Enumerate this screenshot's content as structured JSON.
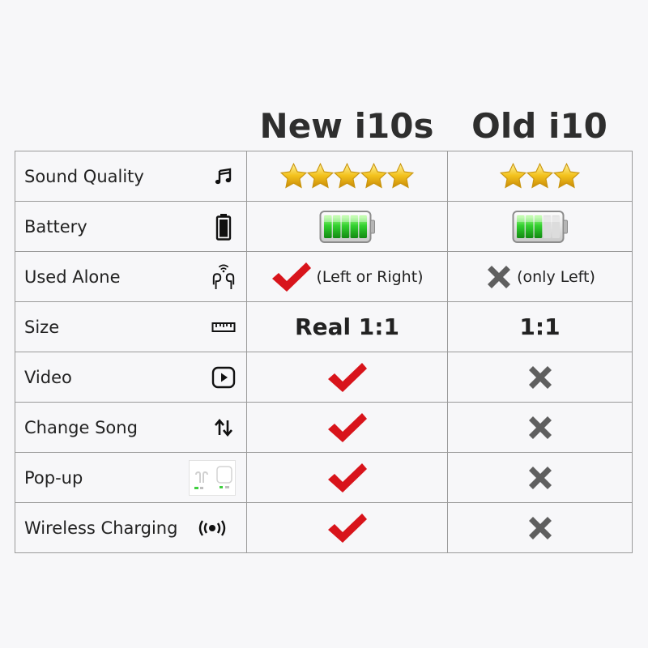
{
  "header": {
    "new_label": "New i10s",
    "old_label": "Old i10"
  },
  "rows": [
    {
      "feature": "Sound Quality",
      "icon": "music-note-icon",
      "new_stars": 5,
      "old_stars": 3
    },
    {
      "feature": "Battery",
      "icon": "battery-icon",
      "new_battery_level": 1.0,
      "old_battery_level": 0.6
    },
    {
      "feature": "Used Alone",
      "icon": "earbuds-icon",
      "new": "check",
      "new_note": "(Left or Right)",
      "old": "cross",
      "old_note": "(only Left)"
    },
    {
      "feature": "Size",
      "icon": "ruler-icon",
      "new_text": "Real 1:1",
      "old_text": "1:1"
    },
    {
      "feature": "Video",
      "icon": "play-icon",
      "new": "check",
      "old": "cross"
    },
    {
      "feature": "Change Song",
      "icon": "swap-arrows-icon",
      "new": "check",
      "old": "cross"
    },
    {
      "feature": "Pop-up",
      "icon": "popup-thumbnail-icon",
      "new": "check",
      "old": "cross"
    },
    {
      "feature": "Wireless Charging",
      "icon": "wireless-charging-icon",
      "new": "check",
      "old": "cross"
    }
  ],
  "colors": {
    "check": "#d8141b",
    "cross": "#5f5f5f",
    "star": "#f0c419",
    "battery_green": "#2fcc2f",
    "border": "#9a9a9a"
  }
}
